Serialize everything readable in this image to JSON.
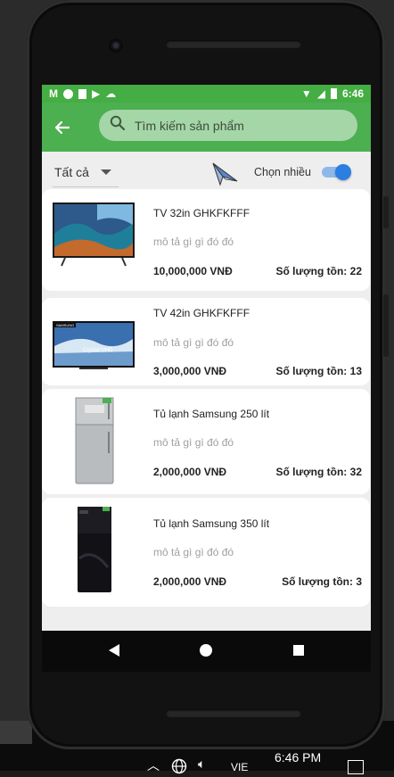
{
  "status_bar": {
    "time": "6:46"
  },
  "search": {
    "placeholder": "Tìm kiếm sản phẩm"
  },
  "filter": {
    "selected": "Tất cả",
    "multi_label": "Chọn nhiều",
    "multi_enabled": true
  },
  "products": [
    {
      "name": "TV 32in GHKFKFFF",
      "desc": "mô tả gì gì đó đó",
      "price": "10,000,000 VNĐ",
      "stock": "Số lượng tồn: 22"
    },
    {
      "name": "TV 42in GHKFKFFF",
      "desc": "mô tả gì gì đó đó",
      "price": "3,000,000 VNĐ",
      "stock": "Số lượng tồn: 13"
    },
    {
      "name": "Tủ lạnh Samsung 250 lít",
      "desc": "mô tả gì gì đó đó",
      "price": "2,000,000 VNĐ",
      "stock": "Số lượng tồn: 32"
    },
    {
      "name": "Tủ lạnh Samsung 350 lít",
      "desc": "mô tả gì gì đó đó",
      "price": "2,000,000 VNĐ",
      "stock": "Số lượng tồn: 3"
    }
  ],
  "taskbar": {
    "time": "6:46 PM",
    "lang": "VIE"
  },
  "colors": {
    "primary": "#4caf50",
    "primary_dark": "#44ad43",
    "switch_on": "#2b7fe0"
  }
}
